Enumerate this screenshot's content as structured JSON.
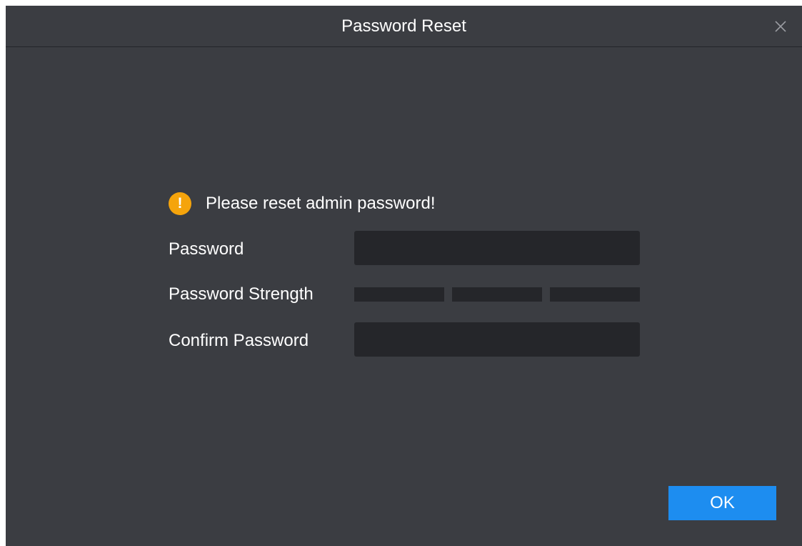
{
  "dialog": {
    "title": "Password Reset",
    "notice": "Please reset admin password!",
    "notice_icon": "warning-icon",
    "close_icon": "close-icon"
  },
  "form": {
    "password_label": "Password",
    "password_value": "",
    "strength_label": "Password Strength",
    "strength_level": 0,
    "strength_segments": 3,
    "confirm_label": "Confirm Password",
    "confirm_value": ""
  },
  "buttons": {
    "ok_label": "OK"
  },
  "colors": {
    "dialog_bg": "#3b3d42",
    "input_bg": "#25262a",
    "warning": "#f5a40c",
    "primary": "#1d8df0"
  }
}
